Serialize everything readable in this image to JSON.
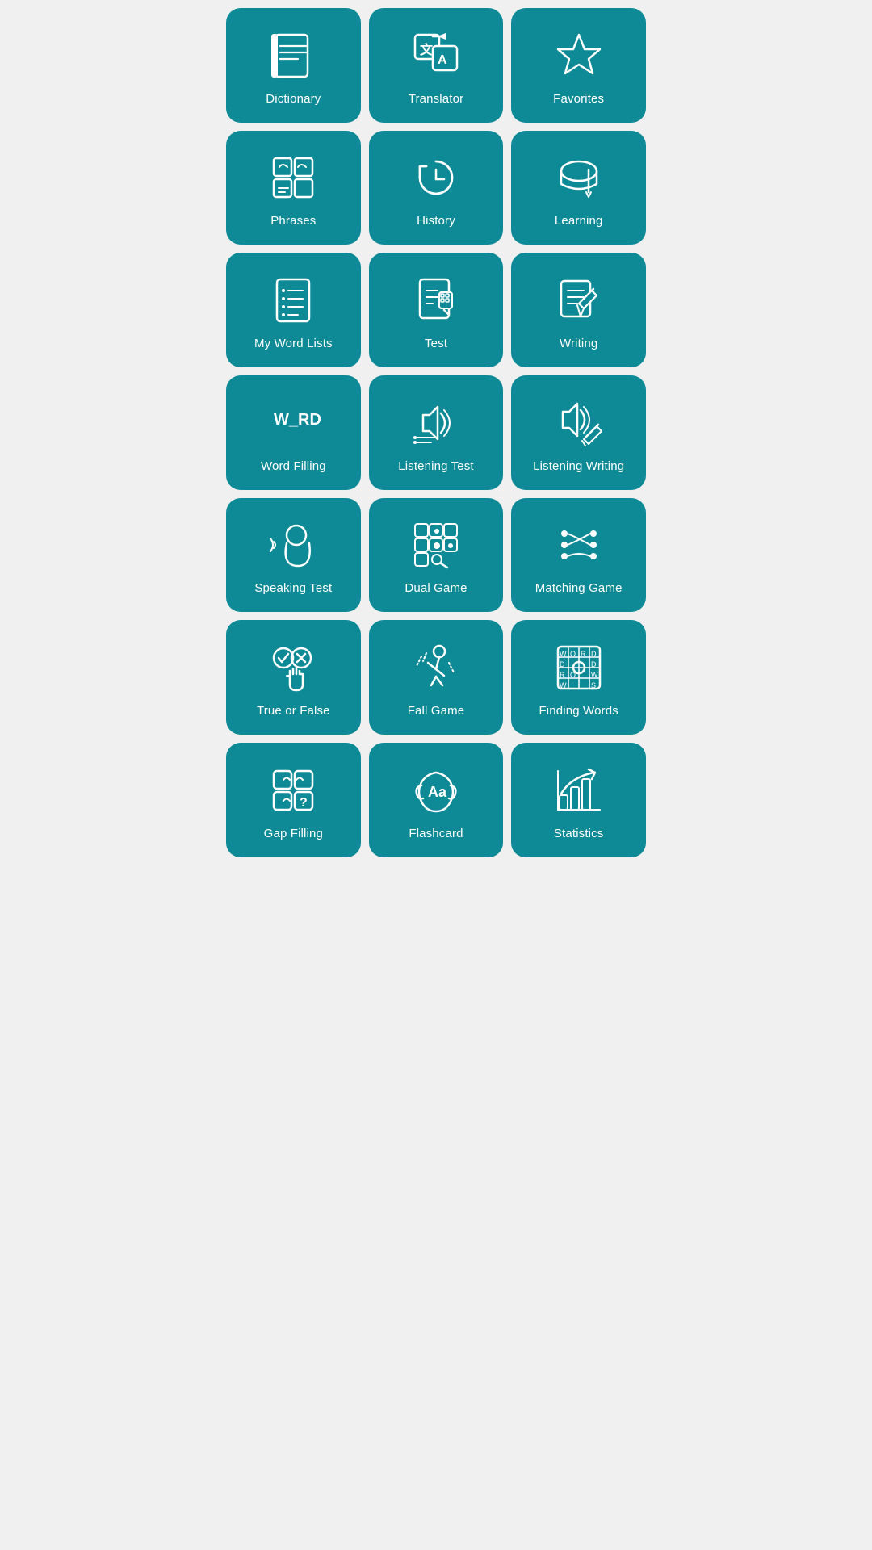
{
  "tiles": [
    {
      "id": "dictionary",
      "label": "Dictionary"
    },
    {
      "id": "translator",
      "label": "Translator"
    },
    {
      "id": "favorites",
      "label": "Favorites"
    },
    {
      "id": "phrases",
      "label": "Phrases"
    },
    {
      "id": "history",
      "label": "History"
    },
    {
      "id": "learning",
      "label": "Learning"
    },
    {
      "id": "my-word-lists",
      "label": "My Word Lists"
    },
    {
      "id": "test",
      "label": "Test"
    },
    {
      "id": "writing",
      "label": "Writing"
    },
    {
      "id": "word-filling",
      "label": "Word Filling"
    },
    {
      "id": "listening-test",
      "label": "Listening Test"
    },
    {
      "id": "listening-writing",
      "label": "Listening Writing"
    },
    {
      "id": "speaking-test",
      "label": "Speaking Test"
    },
    {
      "id": "dual-game",
      "label": "Dual Game"
    },
    {
      "id": "matching-game",
      "label": "Matching Game"
    },
    {
      "id": "true-or-false",
      "label": "True or False"
    },
    {
      "id": "fall-game",
      "label": "Fall Game"
    },
    {
      "id": "finding-words",
      "label": "Finding Words"
    },
    {
      "id": "gap-filling",
      "label": "Gap Filling"
    },
    {
      "id": "flashcard",
      "label": "Flashcard"
    },
    {
      "id": "statistics",
      "label": "Statistics"
    }
  ]
}
